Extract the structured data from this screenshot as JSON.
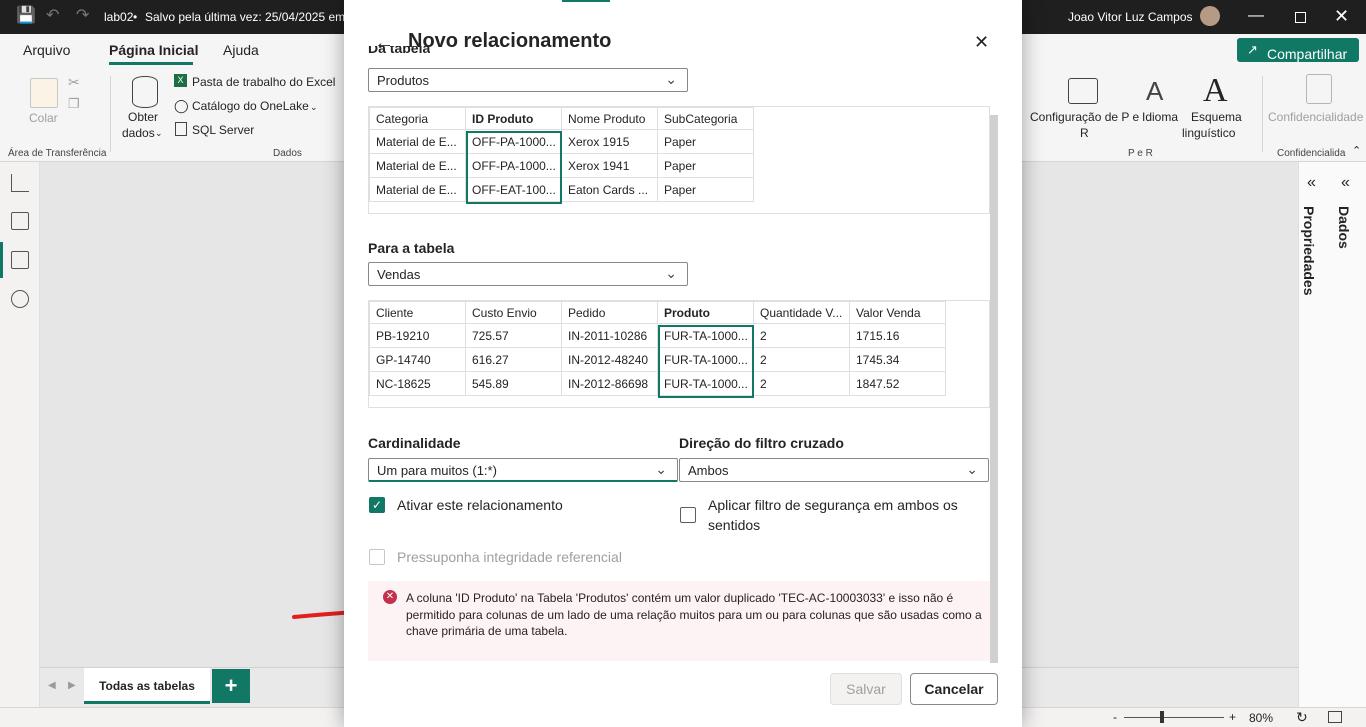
{
  "titlebar": {
    "file": "lab02",
    "saved": "Salvo pela última vez: 25/04/2025 em",
    "user": "Joao Vitor Luz Campos"
  },
  "ribbon_tabs": [
    "Arquivo",
    "Página Inicial",
    "Ajuda"
  ],
  "share_button": "Compartilhar",
  "ribbon": {
    "colar": "Colar",
    "area_transferencia": "Área de Transferência",
    "obter": "Obter",
    "dados_lbl": "dados",
    "excel": "Pasta de trabalho do Excel",
    "onelake": "Catálogo do OneLake",
    "sql": "SQL Server",
    "dados_group": "Dados",
    "config_line1": "Configuração de P e",
    "config_line2": "R",
    "idioma": "Idioma",
    "esquema_line1": "Esquema",
    "esquema_line2": "linguístico",
    "per_group": "P e R",
    "confidencialidade": "Confidencialidade",
    "confidencialidade_group": "Confidencialida"
  },
  "right_pane": {
    "propriedades": "Propriedades",
    "dados": "Dados"
  },
  "bottom": {
    "tab": "Todas as tabelas",
    "add": "+"
  },
  "status": {
    "zoom": "80%"
  },
  "dialog": {
    "title": "Novo relacionamento",
    "from_label": "Da tabela",
    "from_table": "Produtos",
    "from_grid": {
      "headers": [
        "Categoria",
        "ID Produto",
        "Nome Produto",
        "SubCategoria"
      ],
      "rows": [
        [
          "Material de E...",
          "OFF-PA-1000...",
          "Xerox 1915",
          "Paper"
        ],
        [
          "Material de E...",
          "OFF-PA-1000...",
          "Xerox 1941",
          "Paper"
        ],
        [
          "Material de E...",
          "OFF-EAT-100...",
          "Eaton Cards ...",
          "Paper"
        ]
      ]
    },
    "to_label": "Para a tabela",
    "to_table": "Vendas",
    "to_grid": {
      "headers": [
        "Cliente",
        "Custo Envio",
        "Pedido",
        "Produto",
        "Quantidade V...",
        "Valor Venda"
      ],
      "rows": [
        [
          "PB-19210",
          "725.57",
          "IN-2011-10286",
          "FUR-TA-1000...",
          "2",
          "1715.16"
        ],
        [
          "GP-14740",
          "616.27",
          "IN-2012-48240",
          "FUR-TA-1000...",
          "2",
          "1745.34"
        ],
        [
          "NC-18625",
          "545.89",
          "IN-2012-86698",
          "FUR-TA-1000...",
          "2",
          "1847.52"
        ]
      ]
    },
    "cardinality_label": "Cardinalidade",
    "cardinality_value": "Um para muitos (1:*)",
    "filter_label": "Direção do filtro cruzado",
    "filter_value": "Ambos",
    "activate_label": "Ativar este relacionamento",
    "security_label_1": "Aplicar filtro de segurança em ambos os",
    "security_label_2": "sentidos",
    "integrity_label": "Pressuponha integridade referencial",
    "error_line1": "A coluna 'ID Produto' na Tabela 'Produtos' contém um valor duplicado 'TEC-AC-10003033' e isso não é",
    "error_line2": "permitido para colunas de um lado de uma relação muitos para um ou para colunas que são usadas como a",
    "error_line3": "chave primária de uma tabela.",
    "save": "Salvar",
    "cancel": "Cancelar"
  },
  "colors": {
    "accent": "#117865",
    "error": "#c4314b",
    "arrow": "#e0201e"
  }
}
